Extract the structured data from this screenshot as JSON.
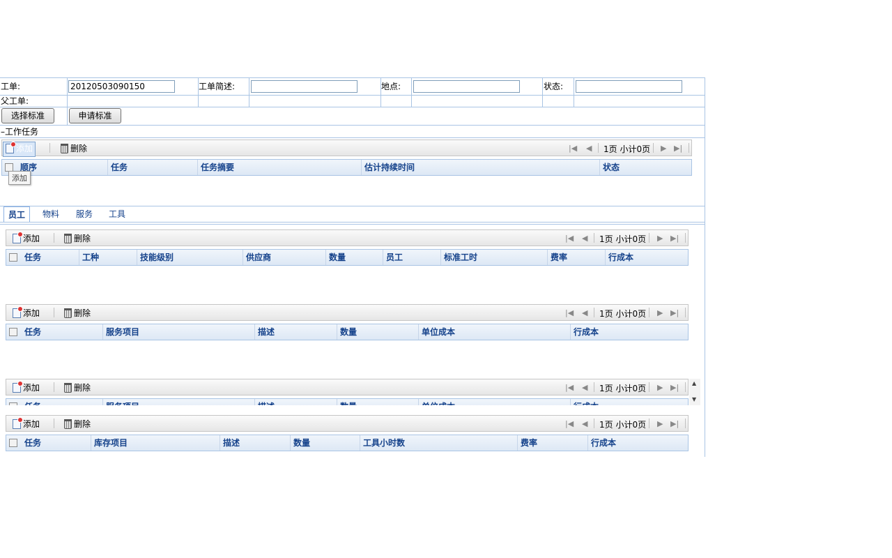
{
  "form": {
    "workorder_label": "工单:",
    "workorder_value": "20120503090150",
    "description_label": "工单简述:",
    "description_value": "",
    "location_label": "地点:",
    "location_value": "",
    "status_label": "状态:",
    "status_value": "",
    "parent_label": "父工单:",
    "select_standard_button": "选择标准",
    "apply_standard_button": "申请标准"
  },
  "tasks_section": {
    "title": "工作任务",
    "add_label": "添加",
    "delete_label": "删除",
    "page_text": "1页 小计0页",
    "columns": [
      "顺序",
      "任务",
      "任务摘要",
      "估计持续时间",
      "状态"
    ],
    "tooltip": "添加"
  },
  "tabs": [
    "员工",
    "物料",
    "服务",
    "工具"
  ],
  "labor_grid": {
    "add_label": "添加",
    "delete_label": "删除",
    "page_text": "1页 小计0页",
    "columns": [
      "任务",
      "工种",
      "技能级别",
      "供应商",
      "数量",
      "员工",
      "标准工时",
      "费率",
      "行成本"
    ]
  },
  "service_grid": {
    "add_label": "添加",
    "delete_label": "删除",
    "page_text": "1页 小计0页",
    "columns": [
      "任务",
      "服务项目",
      "描述",
      "数量",
      "单位成本",
      "行成本"
    ]
  },
  "service_grid_2": {
    "add_label": "添加",
    "delete_label": "删除",
    "page_text": "1页 小计0页",
    "columns": [
      "任务",
      "服务项目",
      "描述",
      "数量",
      "单位成本",
      "行成本"
    ]
  },
  "tool_grid": {
    "add_label": "添加",
    "delete_label": "删除",
    "page_text": "1页 小计0页",
    "columns": [
      "任务",
      "库存项目",
      "描述",
      "数量",
      "工具小时数",
      "费率",
      "行成本"
    ]
  },
  "colors": {
    "border": "#a9c4e4",
    "header_text": "#15428b"
  }
}
